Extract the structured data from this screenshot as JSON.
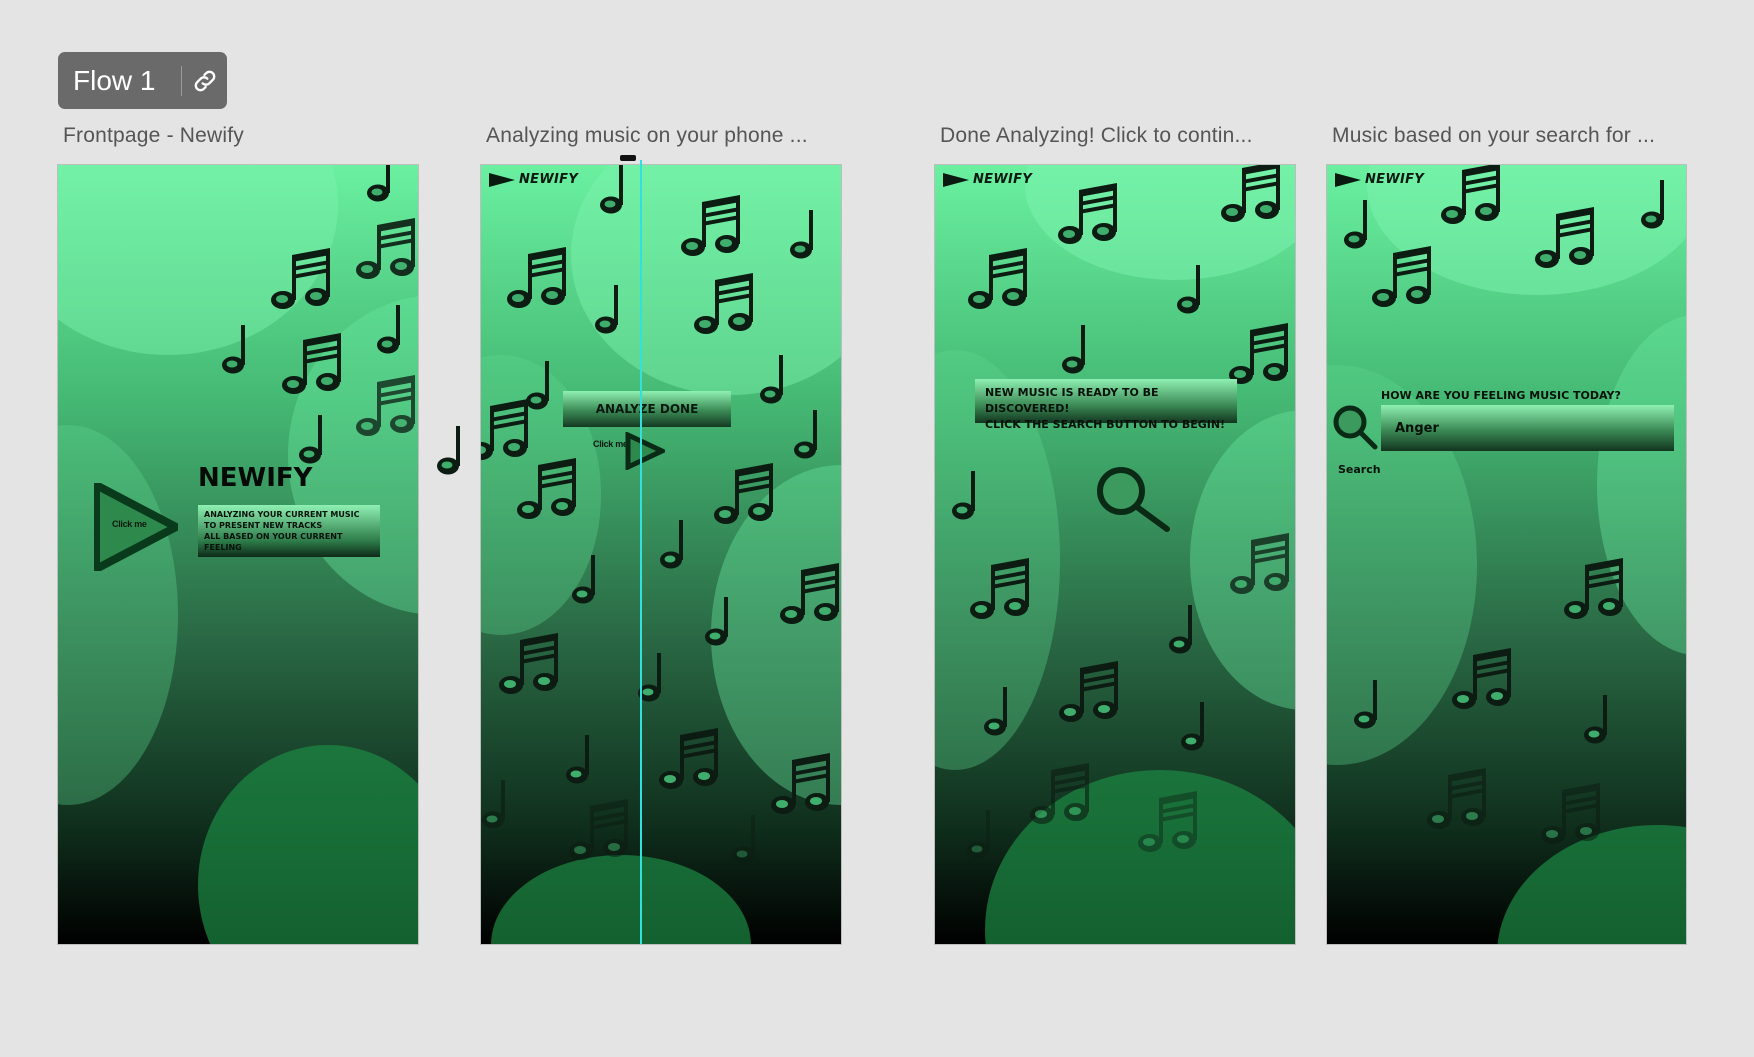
{
  "flow": {
    "label": "Flow 1",
    "link_icon": "link-icon"
  },
  "frames": [
    {
      "title": "Frontpage -  Newify"
    },
    {
      "title": "Analyzing music on your phone ..."
    },
    {
      "title": "Done Analyzing! Click to contin..."
    },
    {
      "title": "Music based on your search for ..."
    }
  ],
  "app": {
    "logo": "NEWIFY",
    "logo_icon": "play-triangle-icon"
  },
  "frontpage": {
    "title": "NEWIFY",
    "description": [
      "ANALYZING YOUR CURRENT MUSIC",
      "TO PRESENT NEW TRACKS",
      "ALL BASED ON YOUR CURRENT FEELING"
    ],
    "play_label": "Click me"
  },
  "analyzing": {
    "banner": "ANALYZE DONE",
    "play_label": "Click me"
  },
  "done": {
    "banner": [
      "NEW MUSIC IS READY TO BE DISCOVERED!",
      "CLICK THE SEARCH BUTTON TO BEGIN!"
    ],
    "search_icon": "search-icon"
  },
  "search": {
    "question": "HOW ARE YOU FEELING MUSIC TODAY?",
    "input_value": "Anger",
    "search_label": "Search"
  },
  "colors": {
    "canvas": "#e4e4e4",
    "badge": "#6a6a6a",
    "green_light": "#6af0a0",
    "green_dark": "#000000",
    "guide": "#33e0e0"
  }
}
